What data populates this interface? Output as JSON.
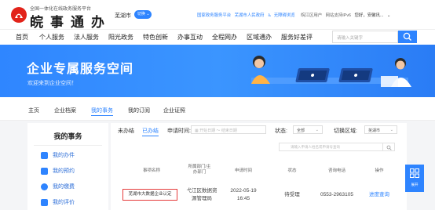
{
  "header": {
    "logo_sub": "全国一体化在线政务服务平台",
    "logo_main": "皖事通办",
    "city": "芜湖市",
    "switch_label": "切换",
    "links": [
      "国家政务服务平台",
      "芜湖市人民政府",
      "无障碍浏览",
      "皖江区用户",
      "网站支持IPv6",
      "您好，安徽讯..."
    ]
  },
  "nav": {
    "items": [
      "首页",
      "个人服务",
      "法人服务",
      "阳光政务",
      "特色创新",
      "办事互动",
      "全程网办",
      "区域通办",
      "服务好差评"
    ],
    "search_placeholder": "请输入关键字"
  },
  "banner": {
    "title": "企业专属服务空间",
    "subtitle": "欢迎来到企业空间！"
  },
  "subnav": {
    "items": [
      "主页",
      "企业档案",
      "我的事务",
      "我的订阅",
      "企业证照"
    ],
    "active_index": 2
  },
  "sidebar": {
    "title": "我的事务",
    "items": [
      "我的办件",
      "我的预约",
      "我的缴费",
      "我的评价"
    ]
  },
  "filters": {
    "tabs": [
      "未办结",
      "已办结"
    ],
    "active_tab": 1,
    "apply_time_label": "申请时间:",
    "date_placeholder": "开始日期 ～ 结束日期",
    "status_label": "状态:",
    "status_value": "全部",
    "region_label": "切换区域:",
    "region_value": "芜湖市",
    "keyword_placeholder": "请输入申请人姓名或申请号查询"
  },
  "table": {
    "headers": [
      "事项名称",
      "所属部门/主办部门",
      "申请时间",
      "状态",
      "咨询电话",
      "操作"
    ],
    "rows": [
      {
        "name": "芜湖市大数据企业认定",
        "dept": "弋江区数据资源管理局",
        "time": "2022-05-19 16:45",
        "status": "待受理",
        "phone": "0553-2963105",
        "action": "进度查询"
      }
    ]
  },
  "float": {
    "label": "展开"
  },
  "colors": {
    "accent": "#2e84ff",
    "highlight_border": "#e63c3c",
    "logo_red": "#e2231a"
  }
}
